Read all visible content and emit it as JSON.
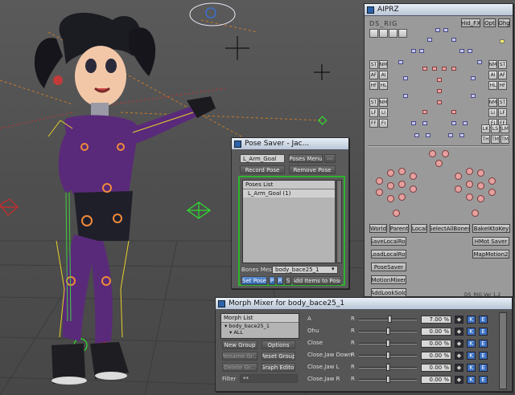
{
  "aiprz": {
    "title": "AIPRZ",
    "ds_label": "DS_RIG",
    "top_buttons": [
      "Hid_FX",
      "Opt",
      "Ohg"
    ],
    "left_pairs": [
      [
        "ST",
        "NM"
      ],
      [
        "AF",
        "AI"
      ],
      [
        "HF",
        "HL"
      ],
      [
        "ST",
        "NM"
      ],
      [
        "LF",
        "LI"
      ],
      [
        "FF",
        "FI"
      ]
    ],
    "right_pairs": [
      [
        "NM",
        "ST"
      ],
      [
        "AI",
        "AF"
      ],
      [
        "HL",
        "HF"
      ],
      [
        "NM",
        "ST"
      ],
      [
        "LI",
        "LF"
      ],
      [
        "FI",
        "FF"
      ]
    ],
    "side_buttons": [
      "LK",
      "LS",
      "LM",
      "TH",
      "TM",
      "TM"
    ],
    "row_buttons": [
      "World",
      "Parent",
      "Local",
      "SelectAllBones",
      "BakeIKtoKey"
    ],
    "list_buttons": [
      "SaveLocalRot",
      "LoadLocalRot",
      "PoseSaver",
      "MotionMixer",
      "AddLookSolo"
    ],
    "right_buttons": [
      "HMot Saver",
      "MapMotion2"
    ],
    "version": "DS_RIG Ver 1.2"
  },
  "pose_saver": {
    "title": "Pose Saver - Jac...",
    "goal_field": "L_Arm_Goal",
    "poses_menu": "Poses Menu",
    "more": "⋯",
    "record_pose": "Record Pose",
    "remove_pose": "Remove Pose",
    "poses_list_header": "Poses List",
    "poses": [
      "L_Arm_Goal (1)"
    ],
    "bones_mesh_label": "Bones Mesh",
    "bones_mesh_value": "body_bace25_1",
    "set_pose": "Set Pose",
    "flags": [
      "P",
      "R",
      "S"
    ],
    "add_items": "Add Items to Pose"
  },
  "morph_mixer": {
    "title": "Morph Mixer for body_bace25_1",
    "list_header": "Morph List",
    "tree": [
      "body_bace25_1",
      "ALL"
    ],
    "buttons": {
      "new_group": "New Group",
      "options": "Options",
      "rename_group": "Rename Gr...",
      "reset_group": "Reset Group",
      "delete_group": "Delete Gr...",
      "graph_editor": "Graph Editor"
    },
    "filter_label": "Filter",
    "filter_value": "**",
    "morphs": [
      {
        "name": "A",
        "mark": "R",
        "value": "7.00 %",
        "level": 0.07
      },
      {
        "name": "Ohu",
        "mark": "R",
        "value": "0.00 %",
        "level": 0
      },
      {
        "name": "Close",
        "mark": "R",
        "value": "0.00 %",
        "level": 0
      },
      {
        "name": "Close.Jaw Down",
        "mark": "R",
        "value": "0.00 %",
        "level": 0
      },
      {
        "name": "Close.Jaw L",
        "mark": "R",
        "value": "0.00 %",
        "level": 0
      },
      {
        "name": "Close.Jaw R",
        "mark": "R",
        "value": "0.00 %",
        "level": 0
      }
    ],
    "key_buttons": [
      "K",
      "E"
    ]
  },
  "colors": {
    "morph_slider_accent": "#3a6fc0",
    "pose_border": "#2db42d",
    "character_suit": "#5a2a7a"
  }
}
